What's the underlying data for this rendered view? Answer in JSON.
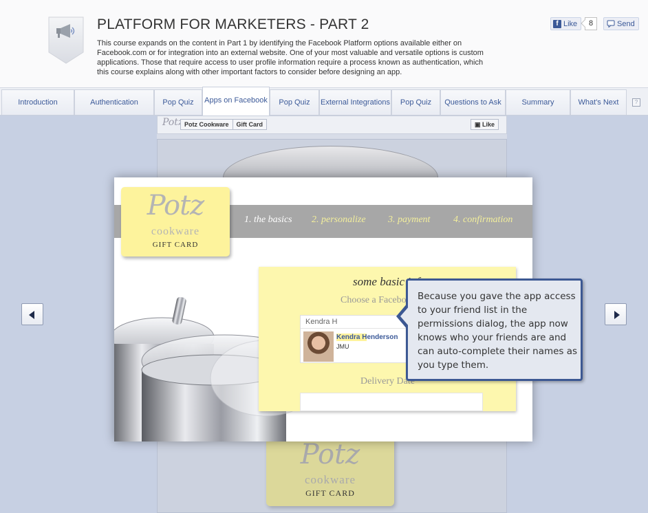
{
  "header": {
    "title": "PLATFORM FOR MARKETERS - PART 2",
    "description": "This course expands on the content in Part 1 by identifying the Facebook Platform options available either on Facebook.com or for integration into an external website. One of your most valuable and versatile options is custom applications. Those that require access to user profile information require a process known as authentication, which this course explains along with other important factors to consider before designing an app.",
    "icon": "megaphone-icon",
    "like_label": "Like",
    "like_count": "8",
    "send_label": "Send"
  },
  "tabs": [
    {
      "label": "Introduction"
    },
    {
      "label": "Authentication"
    },
    {
      "label": "Pop Quiz"
    },
    {
      "label": "Apps on Facebook",
      "active": true
    },
    {
      "label": "Pop Quiz"
    },
    {
      "label": "External Integrations"
    },
    {
      "label": "Pop Quiz"
    },
    {
      "label": "Questions to Ask"
    },
    {
      "label": "Summary"
    },
    {
      "label": "What's Next"
    }
  ],
  "help_label": "?",
  "background_page": {
    "logo": "Potz",
    "breadcrumb": [
      "Potz Cookware",
      "Gift Card"
    ],
    "like_label": "Like",
    "card_logo": "Potz",
    "card_sub": "cookware",
    "card_gift": "GIFT CARD"
  },
  "app": {
    "card_logo": "Potz",
    "card_sub": "cookware",
    "card_gift": "GIFT CARD",
    "steps": [
      "1. the basics",
      "2. personalize",
      "3. payment",
      "4. confirmation"
    ],
    "form_heading": "some basic inf",
    "choose_label": "Choose a Faceboo",
    "friend_input_value": "Kendra H",
    "suggestion_name_match": "Kendra H",
    "suggestion_name_rest": "enderson",
    "suggestion_network": "JMU",
    "delivery_label": "Delivery Date"
  },
  "callout": {
    "text": "Because you gave the app access to your friend list in the permissions dialog, the app now knows who your friends are and can auto-complete their names as you type them."
  },
  "colors": {
    "accent": "#3b5998",
    "callout_border": "#3c5893",
    "card_yellow": "#fdf39c",
    "form_yellow": "#fdf7ae"
  }
}
